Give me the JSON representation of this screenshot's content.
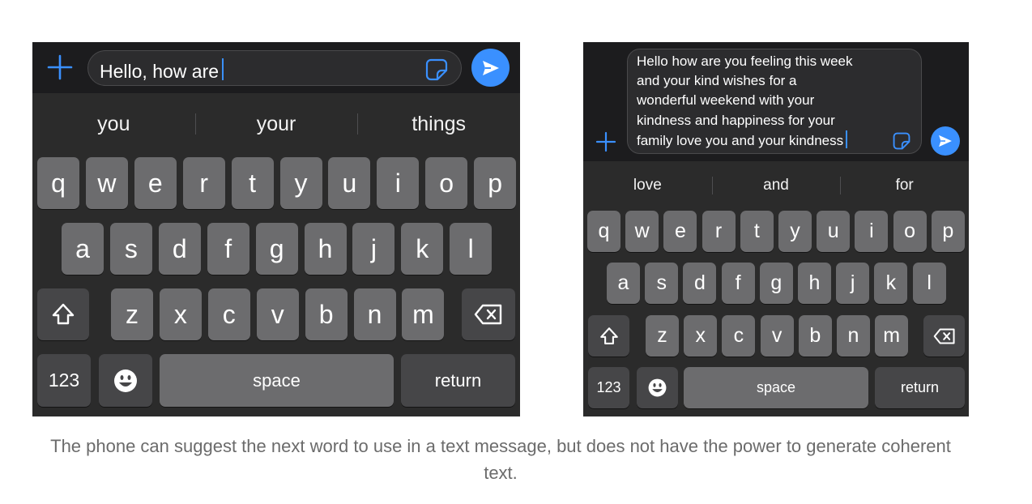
{
  "left_phone": {
    "input_text": "Hello, how are",
    "suggestions": [
      "you",
      "your",
      "things"
    ],
    "rows": [
      [
        "q",
        "w",
        "e",
        "r",
        "t",
        "y",
        "u",
        "i",
        "o",
        "p"
      ],
      [
        "a",
        "s",
        "d",
        "f",
        "g",
        "h",
        "j",
        "k",
        "l"
      ],
      [
        "z",
        "x",
        "c",
        "v",
        "b",
        "n",
        "m"
      ]
    ],
    "numbers_key": "123",
    "space_key": "space",
    "return_key": "return"
  },
  "right_phone": {
    "input_lines": [
      "Hello how are you feeling this week",
      "and your kind wishes for a",
      "wonderful weekend with your",
      "kindness and happiness for your",
      "family love you and your kindness"
    ],
    "suggestions": [
      "love",
      "and",
      "for"
    ],
    "rows": [
      [
        "q",
        "w",
        "e",
        "r",
        "t",
        "y",
        "u",
        "i",
        "o",
        "p"
      ],
      [
        "a",
        "s",
        "d",
        "f",
        "g",
        "h",
        "j",
        "k",
        "l"
      ],
      [
        "z",
        "x",
        "c",
        "v",
        "b",
        "n",
        "m"
      ]
    ],
    "numbers_key": "123",
    "space_key": "space",
    "return_key": "return"
  },
  "caption": "The phone can suggest the next word to use in a text message, but does not have the power to generate coherent text.",
  "colors": {
    "accent": "#3a90ff",
    "key": "#6c6c6e",
    "special_key": "#464648",
    "keyboard_bg": "#2b2b2b",
    "caption_text": "#6b6b6b"
  },
  "icons": [
    "plus-icon",
    "sticker-icon",
    "send-arrow-icon",
    "shift-icon",
    "backspace-icon",
    "emoji-icon"
  ]
}
